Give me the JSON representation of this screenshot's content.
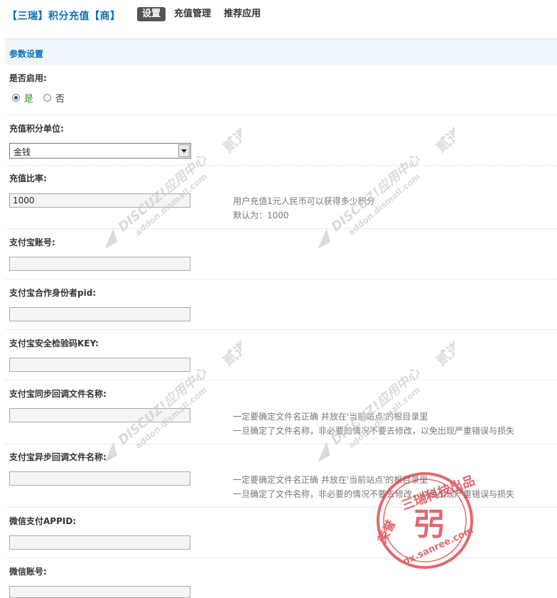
{
  "header": {
    "app_title": "【三瑞】积分充值【商】",
    "tabs": [
      {
        "label": "设置",
        "active": true
      },
      {
        "label": "充值管理",
        "active": false
      },
      {
        "label": "推荐应用",
        "active": false
      }
    ]
  },
  "section": {
    "title": "参数设置"
  },
  "settings": {
    "enable": {
      "label": "是否启用:",
      "yes": "是",
      "no": "否",
      "selected": "是"
    },
    "unit": {
      "label": "充值积分单位:",
      "value": "金钱"
    },
    "ratio": {
      "label": "充值比率:",
      "value": "1000",
      "hint1": "用户充值1元人民币可以获得多少积分",
      "hint2": "默认为：1000"
    },
    "alipay_account": {
      "label": "支付宝账号:",
      "value": ""
    },
    "alipay_pid": {
      "label": "支付宝合作身份者pid:",
      "value": ""
    },
    "alipay_key": {
      "label": "支付宝安全检验码KEY:",
      "value": ""
    },
    "sync_callback": {
      "label": "支付宝同步回调文件名称:",
      "value": "",
      "hint1": "一定要确定文件名正确 并放在'当前站点'的根目录里",
      "hint2": "一旦确定了文件名称，非必要的情况不要去修改，以免出现严重错误与损失"
    },
    "async_callback": {
      "label": "支付宝异步回调文件名称:",
      "value": "",
      "hint1": "一定要确定文件名正确 并放在'当前站点'的根目录里",
      "hint2": "一旦确定了文件名称，非必要的情况不要去修改，以免出现严重错误与损失"
    },
    "wechat_appid": {
      "label": "微信支付APPID:",
      "value": ""
    },
    "wechat_account": {
      "label": "微信账号:",
      "value": ""
    }
  },
  "watermark": {
    "text1": "DISCUZ!应用中心",
    "text2": "addon.dismall.com",
    "text3": "贰道"
  },
  "stamp": {
    "text_top": "三瑞科技出品",
    "text_center": "弜",
    "text_left": "荣誉",
    "text_bottom": "dx.sanree.com"
  },
  "colors": {
    "accent": "#0a6fb8",
    "header_bg": "#eef6fb",
    "active_tab": "#555555",
    "stamp": "#d9363e",
    "radio_on_text": "#1a9a1a"
  }
}
